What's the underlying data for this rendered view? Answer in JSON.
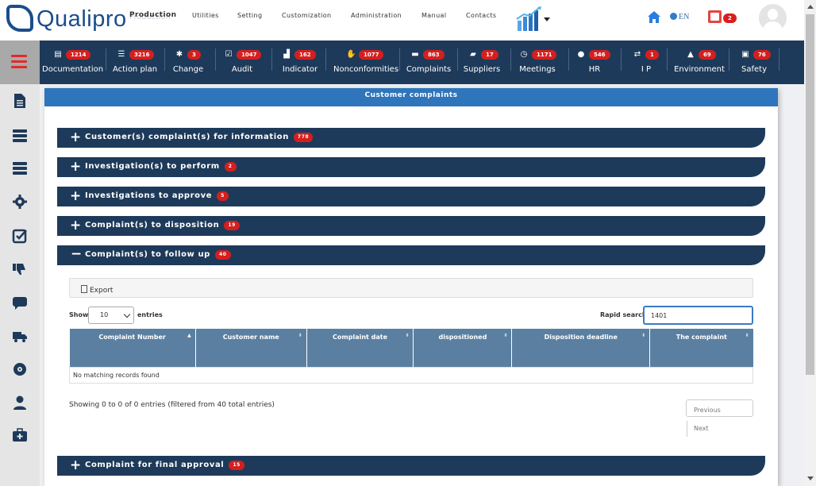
{
  "brand": {
    "name": "Qualipro"
  },
  "top_menu": {
    "items": [
      "Production",
      "Utilities",
      "Setting",
      "Customization",
      "Administration",
      "Manual",
      "Contacts"
    ],
    "selected_ghost": "Production"
  },
  "header_right": {
    "language": "EN",
    "alert_count": "2"
  },
  "modules": [
    {
      "label": "Documentation",
      "count": "1214",
      "icon": "document-icon"
    },
    {
      "label": "Action plan",
      "count": "3216",
      "icon": "list-icon"
    },
    {
      "label": "Change",
      "count": "3",
      "icon": "gear-icon"
    },
    {
      "label": "Audit",
      "count": "1047",
      "icon": "check-square-icon"
    },
    {
      "label": "Indicator",
      "count": "162",
      "icon": "area-chart-icon"
    },
    {
      "label": "Nonconformities",
      "count": "1077",
      "icon": "thumbs-down-icon"
    },
    {
      "label": "Complaints",
      "count": "863",
      "icon": "comment-icon"
    },
    {
      "label": "Suppliers",
      "count": "17",
      "icon": "truck-icon"
    },
    {
      "label": "Meetings",
      "count": "1171",
      "icon": "clock-icon"
    },
    {
      "label": "HR",
      "count": "546",
      "icon": "user-icon"
    },
    {
      "label": "I P",
      "count": "1",
      "icon": "retweet-icon"
    },
    {
      "label": "Environment",
      "count": "69",
      "icon": "bell-icon"
    },
    {
      "label": "Safety",
      "count": "76",
      "icon": "medkit-icon"
    }
  ],
  "panel": {
    "title": "Customer complaints",
    "sections": [
      {
        "title": "Customer(s) complaint(s) for information",
        "count": "778",
        "expanded": false
      },
      {
        "title": "Investigation(s) to perform",
        "count": "2",
        "expanded": false
      },
      {
        "title": "Investigations to approve",
        "count": "5",
        "expanded": false
      },
      {
        "title": "Complaint(s) to disposition",
        "count": "19",
        "expanded": false
      },
      {
        "title": "Complaint(s) to follow up",
        "count": "40",
        "expanded": true
      },
      {
        "title": "Complaint for final approval",
        "count": "15",
        "expanded": false
      }
    ]
  },
  "datatable": {
    "export_label": "Export",
    "show_label": "Show",
    "entries_value": "10",
    "entries_label": "entries",
    "search_label": "Rapid search",
    "search_value": "1401",
    "columns": [
      "Complaint Number",
      "Customer name",
      "Complaint date",
      "dispositioned",
      "Disposition deadline",
      "The complaint"
    ],
    "empty_message": "No matching records found",
    "info": "Showing 0 to 0 of 0 entries (filtered from 40 total entries)",
    "prev_label": "Previous",
    "next_label": "Next"
  }
}
